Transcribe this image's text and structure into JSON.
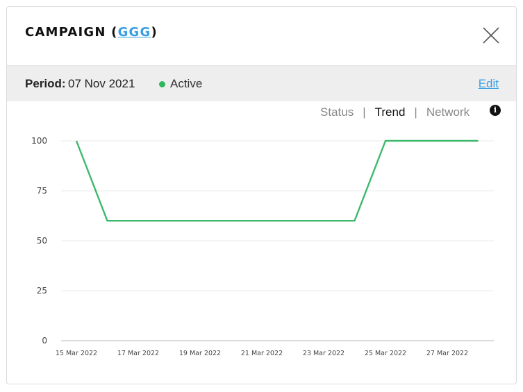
{
  "header": {
    "title_prefix": "CAMPAIGN (",
    "title_link": "GGG",
    "title_suffix": ")",
    "close_icon": "close-icon"
  },
  "period": {
    "label": "Period:",
    "value": "07 Nov 2021",
    "status": "Active",
    "status_color": "#2eb85c",
    "edit_label": "Edit"
  },
  "tabs": {
    "items": [
      "Status",
      "Trend",
      "Network"
    ],
    "separator": "|",
    "active": "Trend",
    "info_icon": "info-icon",
    "info_glyph": "i"
  },
  "chart_data": {
    "type": "line",
    "x": [
      "15 Mar 2022",
      "16 Mar 2022",
      "17 Mar 2022",
      "18 Mar 2022",
      "19 Mar 2022",
      "20 Mar 2022",
      "21 Mar 2022",
      "22 Mar 2022",
      "23 Mar 2022",
      "24 Mar 2022",
      "25 Mar 2022",
      "26 Mar 2022",
      "27 Mar 2022",
      "28 Mar 2022"
    ],
    "x_tick_labels": [
      "15 Mar 2022",
      "17 Mar 2022",
      "19 Mar 2022",
      "21 Mar 2022",
      "23 Mar 2022",
      "25 Mar 2022",
      "27 Mar 2022"
    ],
    "series": [
      {
        "values": [
          100,
          60,
          60,
          60,
          60,
          60,
          60,
          60,
          60,
          60,
          100,
          100,
          100,
          100
        ],
        "color": "#3cb96a"
      }
    ],
    "y_ticks": [
      0,
      25,
      50,
      75,
      100
    ],
    "ylim": [
      0,
      100
    ],
    "grid": true
  }
}
